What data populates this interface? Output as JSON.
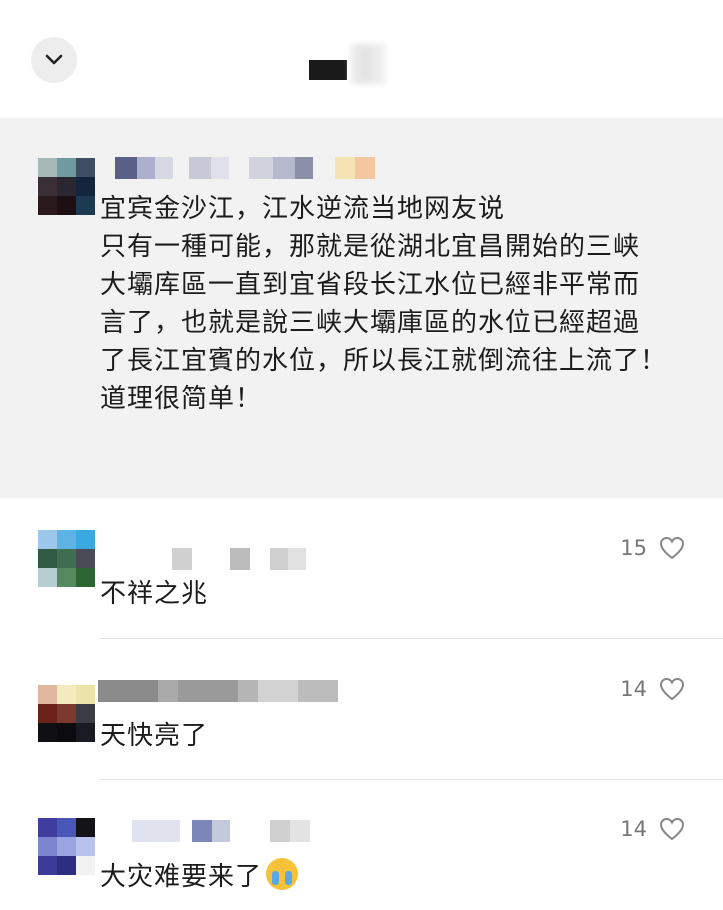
{
  "post": {
    "text": "宜宾金沙江，江水逆流当地网友说\n只有一種可能，那就是從湖北宜昌開始的三峡\n大壩库區一直到宜省段长江水位已經非平常而\n言了，也就是說三峡大壩庫區的水位已經超過\n了長江宜賓的水位，所以長江就倒流往上流了！\n道理很简单！"
  },
  "comments": [
    {
      "text": "不祥之兆",
      "likes": "15"
    },
    {
      "text": "天快亮了",
      "likes": "14"
    },
    {
      "text": "大灾难要来了",
      "likes": "14",
      "emoji": "crying-face-emoji"
    }
  ],
  "colors": {
    "post_bg": "#f2f2f2",
    "text": "#1c1c1c",
    "like_gray": "#777777"
  }
}
